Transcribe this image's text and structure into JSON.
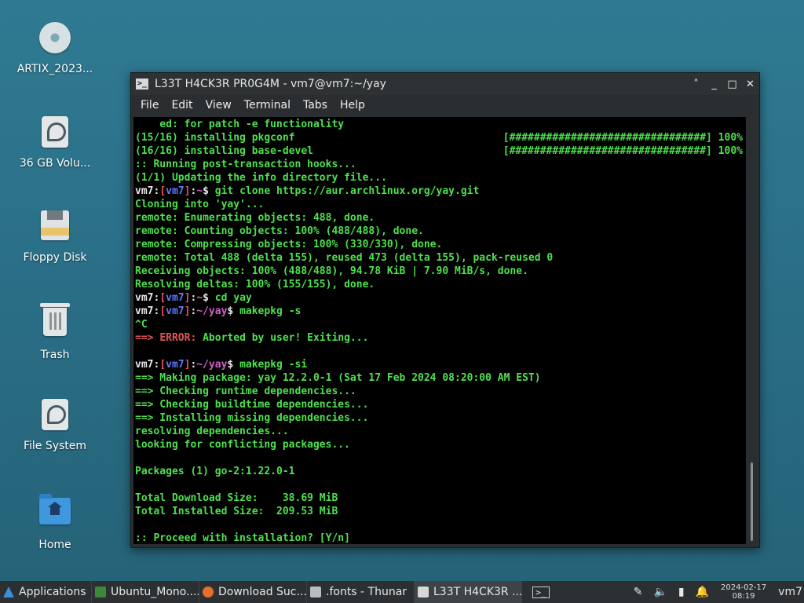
{
  "desktop": {
    "icons": [
      {
        "label": "ARTIX_2023...",
        "icon": "disc-icon"
      },
      {
        "label": "36 GB Volu...",
        "icon": "drive-icon"
      },
      {
        "label": "Floppy Disk",
        "icon": "floppy-icon"
      },
      {
        "label": "Trash",
        "icon": "trash-icon"
      },
      {
        "label": "File System",
        "icon": "drive-icon"
      },
      {
        "label": "Home",
        "icon": "home-folder-icon"
      }
    ]
  },
  "window": {
    "title": "L33T H4CK3R PR0G4M - vm7@vm7:~/yay",
    "app_icon_glyph": ">_",
    "controls": {
      "shade": "˄",
      "minimize": "_",
      "maximize": "□",
      "close": "✕"
    },
    "menu": [
      "File",
      "Edit",
      "View",
      "Terminal",
      "Tabs",
      "Help"
    ]
  },
  "terminal": {
    "lines": [
      {
        "parts": [
          {
            "t": "    ed: for patch -e functionality",
            "c": "g"
          }
        ]
      },
      {
        "parts": [
          {
            "t": "(15/16) installing pkgconf",
            "c": "g"
          }
        ],
        "right": "[################################] 100%"
      },
      {
        "parts": [
          {
            "t": "(16/16) installing base-devel",
            "c": "g"
          }
        ],
        "right": "[################################] 100%"
      },
      {
        "parts": [
          {
            "t": ":: Running post-transaction hooks...",
            "c": "g"
          }
        ]
      },
      {
        "parts": [
          {
            "t": "(1/1) Updating the info directory file...",
            "c": "g"
          }
        ]
      },
      {
        "parts": [
          {
            "t": "vm7",
            "c": "w"
          },
          {
            "t": ":",
            "c": "w"
          },
          {
            "t": "[",
            "c": "r"
          },
          {
            "t": "vm7",
            "c": "b"
          },
          {
            "t": "]",
            "c": "r"
          },
          {
            "t": ":",
            "c": "w"
          },
          {
            "t": "~",
            "c": "m"
          },
          {
            "t": "$ ",
            "c": "w"
          },
          {
            "t": "git clone https://aur.archlinux.org/yay.git",
            "c": "g"
          }
        ]
      },
      {
        "parts": [
          {
            "t": "Cloning into 'yay'...",
            "c": "g"
          }
        ]
      },
      {
        "parts": [
          {
            "t": "remote: Enumerating objects: 488, done.",
            "c": "g"
          }
        ]
      },
      {
        "parts": [
          {
            "t": "remote: Counting objects: 100% (488/488), done.",
            "c": "g"
          }
        ]
      },
      {
        "parts": [
          {
            "t": "remote: Compressing objects: 100% (330/330), done.",
            "c": "g"
          }
        ]
      },
      {
        "parts": [
          {
            "t": "remote: Total 488 (delta 155), reused 473 (delta 155), pack-reused 0",
            "c": "g"
          }
        ]
      },
      {
        "parts": [
          {
            "t": "Receiving objects: 100% (488/488), 94.78 KiB | 7.90 MiB/s, done.",
            "c": "g"
          }
        ]
      },
      {
        "parts": [
          {
            "t": "Resolving deltas: 100% (155/155), done.",
            "c": "g"
          }
        ]
      },
      {
        "parts": [
          {
            "t": "vm7",
            "c": "w"
          },
          {
            "t": ":",
            "c": "w"
          },
          {
            "t": "[",
            "c": "r"
          },
          {
            "t": "vm7",
            "c": "b"
          },
          {
            "t": "]",
            "c": "r"
          },
          {
            "t": ":",
            "c": "w"
          },
          {
            "t": "~",
            "c": "m"
          },
          {
            "t": "$ ",
            "c": "w"
          },
          {
            "t": "cd yay",
            "c": "g"
          }
        ]
      },
      {
        "parts": [
          {
            "t": "vm7",
            "c": "w"
          },
          {
            "t": ":",
            "c": "w"
          },
          {
            "t": "[",
            "c": "r"
          },
          {
            "t": "vm7",
            "c": "b"
          },
          {
            "t": "]",
            "c": "r"
          },
          {
            "t": ":",
            "c": "w"
          },
          {
            "t": "~/yay",
            "c": "m"
          },
          {
            "t": "$ ",
            "c": "w"
          },
          {
            "t": "makepkg -s",
            "c": "g"
          }
        ]
      },
      {
        "parts": [
          {
            "t": "^C",
            "c": "g"
          }
        ]
      },
      {
        "parts": [
          {
            "t": "==> ",
            "c": "r"
          },
          {
            "t": "ERROR:",
            "c": "r"
          },
          {
            "t": " Aborted by user! Exiting...",
            "c": "g"
          }
        ]
      },
      {
        "parts": [
          {
            "t": "",
            "c": "g"
          }
        ]
      },
      {
        "parts": [
          {
            "t": "vm7",
            "c": "w"
          },
          {
            "t": ":",
            "c": "w"
          },
          {
            "t": "[",
            "c": "r"
          },
          {
            "t": "vm7",
            "c": "b"
          },
          {
            "t": "]",
            "c": "r"
          },
          {
            "t": ":",
            "c": "w"
          },
          {
            "t": "~/yay",
            "c": "m"
          },
          {
            "t": "$ ",
            "c": "w"
          },
          {
            "t": "makepkg -si",
            "c": "g"
          }
        ]
      },
      {
        "parts": [
          {
            "t": "==> Making package: yay 12.2.0-1 (Sat 17 Feb 2024 08:20:00 AM EST)",
            "c": "g"
          }
        ]
      },
      {
        "parts": [
          {
            "t": "==> Checking runtime dependencies...",
            "c": "g"
          }
        ]
      },
      {
        "parts": [
          {
            "t": "==> Checking buildtime dependencies...",
            "c": "g"
          }
        ]
      },
      {
        "parts": [
          {
            "t": "==> Installing missing dependencies...",
            "c": "g"
          }
        ]
      },
      {
        "parts": [
          {
            "t": "resolving dependencies...",
            "c": "g"
          }
        ]
      },
      {
        "parts": [
          {
            "t": "looking for conflicting packages...",
            "c": "g"
          }
        ]
      },
      {
        "parts": [
          {
            "t": "",
            "c": "g"
          }
        ]
      },
      {
        "parts": [
          {
            "t": "Packages (1) go-2:1.22.0-1",
            "c": "g"
          }
        ]
      },
      {
        "parts": [
          {
            "t": "",
            "c": "g"
          }
        ]
      },
      {
        "parts": [
          {
            "t": "Total Download Size:    38.69 MiB",
            "c": "g"
          }
        ]
      },
      {
        "parts": [
          {
            "t": "Total Installed Size:  209.53 MiB",
            "c": "g"
          }
        ]
      },
      {
        "parts": [
          {
            "t": "",
            "c": "g"
          }
        ]
      },
      {
        "parts": [
          {
            "t": ":: Proceed with installation? [Y/n]",
            "c": "g"
          }
        ]
      }
    ]
  },
  "taskbar": {
    "start_label": "Applications",
    "tasks": [
      {
        "label": "Ubuntu_Mono....",
        "icon": "document-icon",
        "color": "#3b8a3a"
      },
      {
        "label": "Download Suc...",
        "icon": "firefox-icon",
        "color": "#e66f2a"
      },
      {
        "label": ".fonts - Thunar",
        "icon": "folder-icon",
        "color": "#b9bdc0"
      },
      {
        "label": "L33T H4CK3R ...",
        "icon": "terminal-icon",
        "color": "#d8d8d8"
      }
    ],
    "launcher_glyph": ">_",
    "tray_icons": [
      "pen-icon",
      "volume-icon",
      "battery-icon",
      "bell-icon"
    ],
    "clock_date": "2024-02-17",
    "clock_time": "08:19",
    "user": "vm7"
  },
  "colors": {
    "terminal_green": "#4ee04e",
    "error_red": "#e05555",
    "host_blue": "#5b7bff",
    "path_magenta": "#d060c8"
  }
}
